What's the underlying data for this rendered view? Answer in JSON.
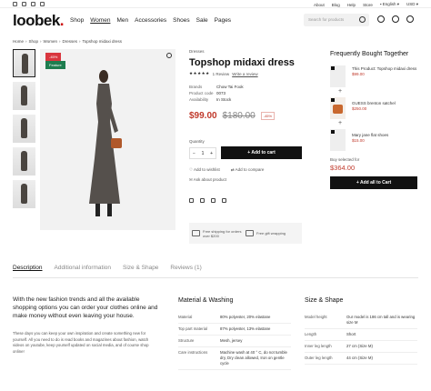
{
  "topbar": {
    "links": [
      "About",
      "Blog",
      "Help",
      "Store",
      "English",
      "USD"
    ]
  },
  "header": {
    "logo": "loobek",
    "nav": [
      "Shop",
      "Women",
      "Men",
      "Accessories",
      "Shoes",
      "Sale",
      "Pages"
    ],
    "active_nav": "Women",
    "search_placeholder": "Search for products"
  },
  "breadcrumb": [
    "Home",
    "Shop",
    "Women",
    "Dresses",
    "Topshop midaxi dress"
  ],
  "gallery": {
    "badge_discount": "-45%",
    "badge_feature": "Feature",
    "colors": {
      "discount": "#d9363e",
      "feature": "#1e7d4f"
    }
  },
  "product": {
    "category": "Dresses",
    "title": "Topshop midaxi dress",
    "stars": "★★★★★",
    "reviews": "1 Review",
    "write_review": "Write a review",
    "specs": [
      {
        "k": "Brands",
        "v": "Chow Tai Fook"
      },
      {
        "k": "Product code",
        "v": "0073"
      },
      {
        "k": "Availability",
        "v": "In Stock"
      }
    ],
    "price": "$99.00",
    "old_price": "$180.00",
    "discount": "-45%",
    "quantity_label": "Quantity",
    "quantity_value": "1",
    "add_to_cart": "+ Add to cart",
    "add_to_wishlist": "Add to wishlist",
    "add_to_compare": "Add to compare",
    "ask_about": "Ask about product",
    "shipping_1": "Free shipping for orders over $200",
    "shipping_2": "Free gift wrapping"
  },
  "fbt": {
    "title": "Frequently Bought Together",
    "items": [
      {
        "name": "This Product: Topshop midaxi dress",
        "price": "$99.00"
      },
      {
        "name": "GUESS brenton satchel",
        "price": "$250.00"
      },
      {
        "name": "Mary jane flat shoes",
        "price": "$15.00"
      }
    ],
    "buy_selected_label": "Buy selected for",
    "total": "$364.00",
    "add_all": "+ Add all to Cart"
  },
  "tabs": [
    "Description",
    "Additional information",
    "Size & Shape",
    "Reviews (1)"
  ],
  "description": {
    "lead": "With the new fashion trends and all the available shopping options you can order your clothes online and make money without even leaving your house.",
    "body": "These days you can keep your own inspiration and create something new for yourself. All you need to do is read books and magazines about fashion, watch videos on youtube, keep yourself updated on social media, and of course shop online!"
  },
  "material": {
    "title": "Material & Washing",
    "rows": [
      {
        "k": "Material",
        "v": "80% polyester, 20% elastane"
      },
      {
        "k": "Top part material",
        "v": "87% polyester, 13% elastane"
      },
      {
        "k": "Structure",
        "v": "Mesh, jersey"
      },
      {
        "k": "Care instructions",
        "v": "Machine wash at 40 ° C, do not tumble dry, Dry clean allowed, Iron on gentle cycle"
      }
    ]
  },
  "size": {
    "title": "Size & Shape",
    "rows": [
      {
        "k": "Model height",
        "v": "Our model is 186 cm tall and is wearing size M"
      },
      {
        "k": "Length",
        "v": "Short"
      },
      {
        "k": "Inner leg length",
        "v": "27 cm (Size M)"
      },
      {
        "k": "Outer leg length",
        "v": "44 cm (Size M)"
      }
    ]
  }
}
